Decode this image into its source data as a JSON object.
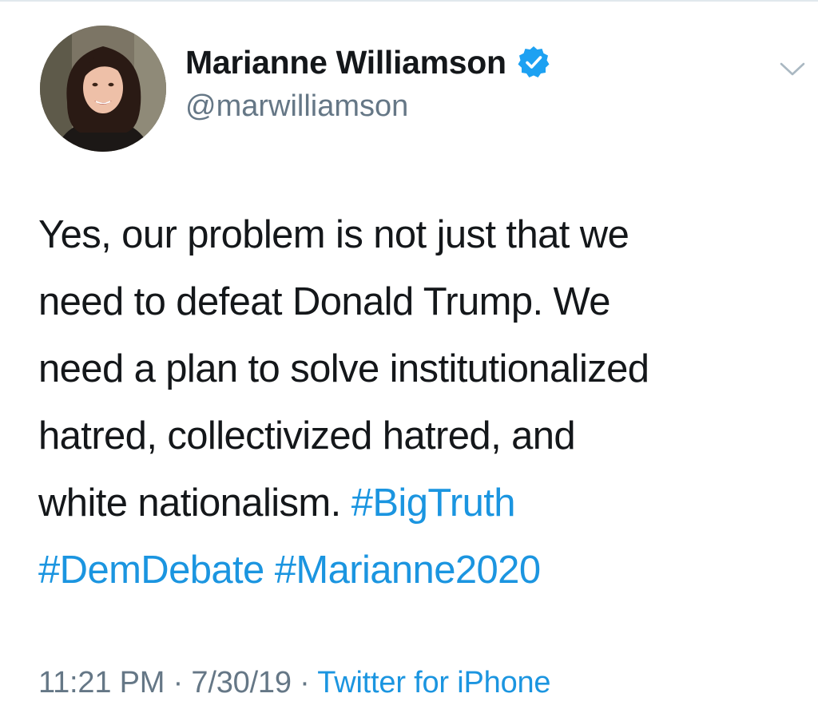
{
  "author": {
    "display_name": "Marianne Williamson",
    "handle": "@marwilliamson",
    "verified": true,
    "avatar_icon": "profile-photo-avatar"
  },
  "tweet": {
    "lines": [
      [
        {
          "text": "Yes, our problem is not just that we",
          "type": "text"
        }
      ],
      [
        {
          "text": "need to defeat Donald Trump. We",
          "type": "text"
        }
      ],
      [
        {
          "text": "need a plan to solve institutionalized",
          "type": "text"
        }
      ],
      [
        {
          "text": "hatred, collectivized hatred, and",
          "type": "text"
        }
      ],
      [
        {
          "text": "white nationalism. ",
          "type": "text"
        },
        {
          "text": "#BigTruth",
          "type": "hashtag"
        }
      ],
      [
        {
          "text": "#DemDebate",
          "type": "hashtag"
        },
        {
          "text": " ",
          "type": "text"
        },
        {
          "text": "#Marianne2020",
          "type": "hashtag"
        }
      ]
    ]
  },
  "meta": {
    "time": "11:21 PM",
    "separator": " · ",
    "date": "7/30/19",
    "source": "Twitter for iPhone"
  },
  "icons": {
    "verified": "verified-badge-icon",
    "menu": "chevron-down-icon"
  },
  "colors": {
    "link": "#1b95e0",
    "verified": "#1da1f2",
    "secondary_text": "#657786",
    "primary_text": "#14171a"
  }
}
